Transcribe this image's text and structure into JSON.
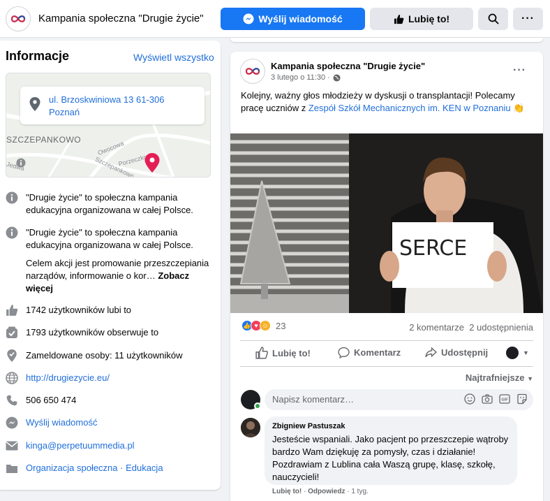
{
  "header": {
    "page_name": "Kampania społeczna \"Drugie życie\"",
    "message_button": "Wyślij wiadomość",
    "like_button": "Lubię to!"
  },
  "info": {
    "title": "Informacje",
    "see_all": "Wyświetl wszystko",
    "map": {
      "address": "ul. Brzoskwiniowa 13 61-306 Poznań",
      "district": "SZCZEPANKOWO",
      "streets": [
        "Owocowa",
        "Porzeczkowa",
        "Szczepankowo",
        "Jedwa"
      ]
    },
    "about_1": "\"Drugie życie\" to społeczna kampania edukacyjna organizowana w całej Polsce.",
    "about_2": "\"Drugie życie\" to społeczna kampania edukacyjna organizowana w całej Polsce.",
    "about_3": "Celem akcji jest promowanie przeszczepiania narządów, informowanie o kor…",
    "see_more": "Zobacz więcej",
    "likes": "1742 użytkowników lubi to",
    "followers": "1793 użytkowników obserwuje to",
    "checkins": "Zameldowane osoby: 11 użytkowników",
    "website": "http://drugiezycie.eu/",
    "phone": "506 650 474",
    "send_message": "Wyślij wiadomość",
    "email": "kinga@perpetuummedia.pl",
    "category": "Organizacja społeczna · Edukacja"
  },
  "post": {
    "author": "Kampania społeczna \"Drugie życie\"",
    "date": "3 lutego o 11:30 ·",
    "text_before": "Kolejny, ważny głos młodzieży w dyskusji o transplantacji! Polecamy pracę uczniów z ",
    "text_link": "Zespół Szkół Mechanicznych im. KEN w Poznaniu",
    "text_after": " 👏",
    "image_sign": "SERCE",
    "reaction_count": "23",
    "stats": "2 komentarze  2 udostępnienia",
    "actions": {
      "like": "Lubię to!",
      "comment": "Komentarz",
      "share": "Udostępnij"
    },
    "sort": "Najtrafniejsze",
    "comment_placeholder": "Napisz komentarz…"
  },
  "comment": {
    "author": "Zbigniew Pastuszak",
    "text": "Jesteście wspaniali. Jako pacjent po przeszczepie wątroby bardzo Wam dziękuję za pomysły, czas i działanie! Pozdrawiam z Lublina cała Waszą grupę, klasę, szkołę, nauczycieli!",
    "like": "Lubię to!",
    "reply": "Odpowiedz",
    "time": "1 tyg."
  },
  "colors": {
    "brand_blue": "#1877f2",
    "link_blue": "#216fdb",
    "map_pin": "#e41e55",
    "online": "#31a24c"
  }
}
